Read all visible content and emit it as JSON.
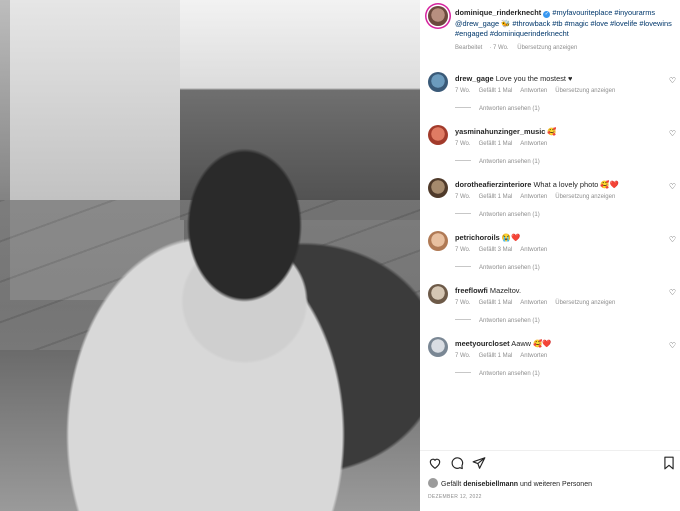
{
  "post": {
    "username": "dominique_rinderknecht",
    "caption_tags_1": "#myfavouriteplace #inyourarms",
    "caption_mention": "@drew_gage",
    "caption_tags_2": "#throwback #tb #magic #love #lovelife #lovewins #engaged #dominiquerinderknecht",
    "edited_label": "Bearbeitet",
    "age": "7 Wo.",
    "translate_label": "Übersetzung anzeigen"
  },
  "comments": [
    {
      "user": "drew_gage",
      "text": "Love you the mostest ♥",
      "age": "7 Wo.",
      "likes": "Gefällt 1 Mal",
      "reply": "Antworten",
      "translate": "Übersetzung anzeigen",
      "replies": "Antworten ansehen (1)"
    },
    {
      "user": "yasminahunzinger_music",
      "text": "🥰",
      "age": "7 Wo.",
      "likes": "Gefällt 1 Mal",
      "reply": "Antworten",
      "translate": "",
      "replies": "Antworten ansehen (1)"
    },
    {
      "user": "dorotheafierzinteriore",
      "text": "What a lovely photo 🥰❤️",
      "age": "7 Wo.",
      "likes": "Gefällt 1 Mal",
      "reply": "Antworten",
      "translate": "Übersetzung anzeigen",
      "replies": "Antworten ansehen (1)"
    },
    {
      "user": "petrichoroils",
      "text": "😭❤️",
      "age": "7 Wo.",
      "likes": "Gefällt 3 Mal",
      "reply": "Antworten",
      "translate": "",
      "replies": "Antworten ansehen (1)"
    },
    {
      "user": "freeflowfi",
      "text": "Mazeltov.",
      "age": "7 Wo.",
      "likes": "Gefällt 1 Mal",
      "reply": "Antworten",
      "translate": "Übersetzung anzeigen",
      "replies": "Antworten ansehen (1)"
    },
    {
      "user": "meetyourcloset",
      "text": "Aaww 🥰❤️",
      "age": "7 Wo.",
      "likes": "Gefällt 1 Mal",
      "reply": "Antworten",
      "translate": "",
      "replies": "Antworten ansehen (1)"
    }
  ],
  "footer": {
    "liked_prefix": "Gefällt ",
    "liked_user": "denisebiellmann",
    "liked_suffix": " und weiteren Personen",
    "date": "DEZEMBER 12, 2022"
  },
  "icons": [
    "heart-icon",
    "comment-icon",
    "share-icon",
    "bookmark-icon",
    "verified-icon"
  ]
}
